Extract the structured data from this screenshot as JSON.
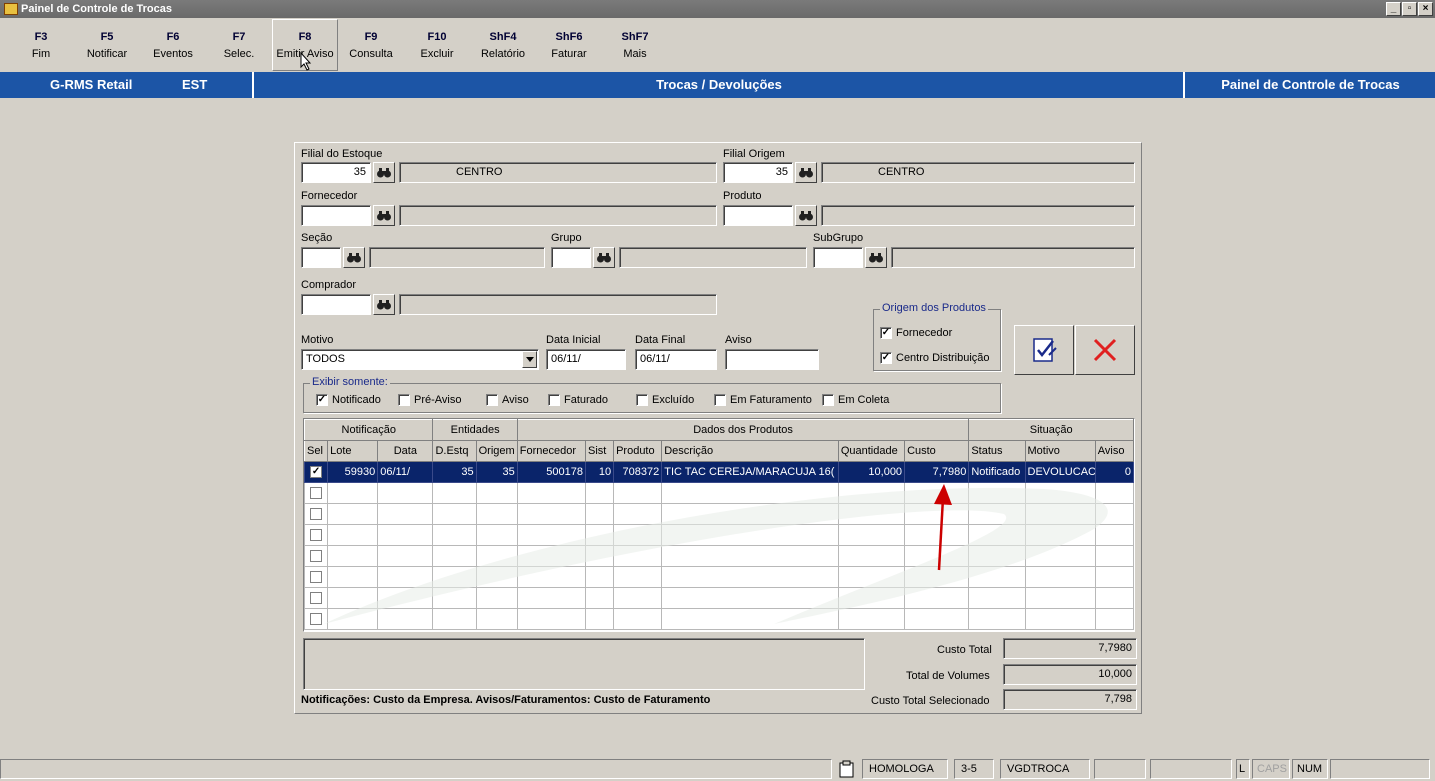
{
  "window": {
    "title": "Painel de Controle de Trocas"
  },
  "fkeys": [
    {
      "key": "F3",
      "label": "Fim"
    },
    {
      "key": "F5",
      "label": "Notificar"
    },
    {
      "key": "F6",
      "label": "Eventos"
    },
    {
      "key": "F7",
      "label": "Selec."
    },
    {
      "key": "F8",
      "label": "Emitir Aviso"
    },
    {
      "key": "F9",
      "label": "Consulta"
    },
    {
      "key": "F10",
      "label": "Excluir"
    },
    {
      "key": "ShF4",
      "label": "Relatório"
    },
    {
      "key": "ShF6",
      "label": "Faturar"
    },
    {
      "key": "ShF7",
      "label": "Mais"
    }
  ],
  "header": {
    "app": "G-RMS Retail",
    "module": "EST",
    "section": "Trocas / Devoluções",
    "screen": "Painel de Controle de Trocas"
  },
  "form": {
    "filial_estoque": {
      "label": "Filial do Estoque",
      "code": "35",
      "name": "CENTRO"
    },
    "filial_origem": {
      "label": "Filial Origem",
      "code": "35",
      "name": "CENTRO"
    },
    "fornecedor": {
      "label": "Fornecedor",
      "code": "",
      "name": ""
    },
    "produto": {
      "label": "Produto",
      "code": "",
      "name": ""
    },
    "secao": {
      "label": "Seção",
      "code": "",
      "name": ""
    },
    "grupo": {
      "label": "Grupo",
      "code": "",
      "name": ""
    },
    "subgrupo": {
      "label": "SubGrupo",
      "code": "",
      "name": ""
    },
    "comprador": {
      "label": "Comprador",
      "code": "",
      "name": ""
    },
    "motivo": {
      "label": "Motivo",
      "value": "TODOS"
    },
    "data_inicial": {
      "label": "Data Inicial",
      "value": "06/11/"
    },
    "data_final": {
      "label": "Data Final",
      "value": "06/11/"
    },
    "aviso": {
      "label": "Aviso",
      "value": ""
    },
    "origem": {
      "title": "Origem dos Produtos",
      "fornecedor": "Fornecedor",
      "centro": "Centro Distribuição"
    },
    "exibir": {
      "title": "Exibir somente:",
      "options": [
        {
          "label": "Notificado",
          "checked": true
        },
        {
          "label": "Pré-Aviso",
          "checked": false
        },
        {
          "label": "Aviso",
          "checked": false
        },
        {
          "label": "Faturado",
          "checked": false
        },
        {
          "label": "Excluído",
          "checked": false
        },
        {
          "label": "Em Faturamento",
          "checked": false
        },
        {
          "label": "Em Coleta",
          "checked": false
        }
      ]
    }
  },
  "grid": {
    "groups": [
      "Notificação",
      "Entidades",
      "Dados dos Produtos",
      "Situação"
    ],
    "columns": [
      "Sel",
      "Lote",
      "Data",
      "D.Estq",
      "Origem",
      "Fornecedor",
      "Sist",
      "Produto",
      "Descrição",
      "Quantidade",
      "Custo",
      "Status",
      "Motivo",
      "Aviso"
    ],
    "rows": [
      [
        "59930",
        "06/11/",
        "35",
        "35",
        "500178",
        "10",
        "708372",
        "TIC TAC CEREJA/MARACUJA 16(",
        "10,000",
        "7,7980",
        "Notificado",
        "DEVOLUCAC",
        "0"
      ]
    ]
  },
  "totals": {
    "custo_total_label": "Custo Total",
    "custo_total": "7,7980",
    "volumes_label": "Total de Volumes",
    "volumes": "10,000",
    "selecionado_label": "Custo Total Selecionado",
    "selecionado": "7,798"
  },
  "note": "Notificações: Custo da Empresa. Avisos/Faturamentos: Custo de Faturamento",
  "statusbar": {
    "env": "HOMOLOGA",
    "ver": "3-5",
    "prog": "VGDTROCA",
    "l": "L",
    "caps": "CAPS",
    "num": "NUM"
  },
  "colors": {
    "header_blue": "#1c55a6",
    "selection": "#0a246a",
    "arrow": "#cc0000"
  }
}
